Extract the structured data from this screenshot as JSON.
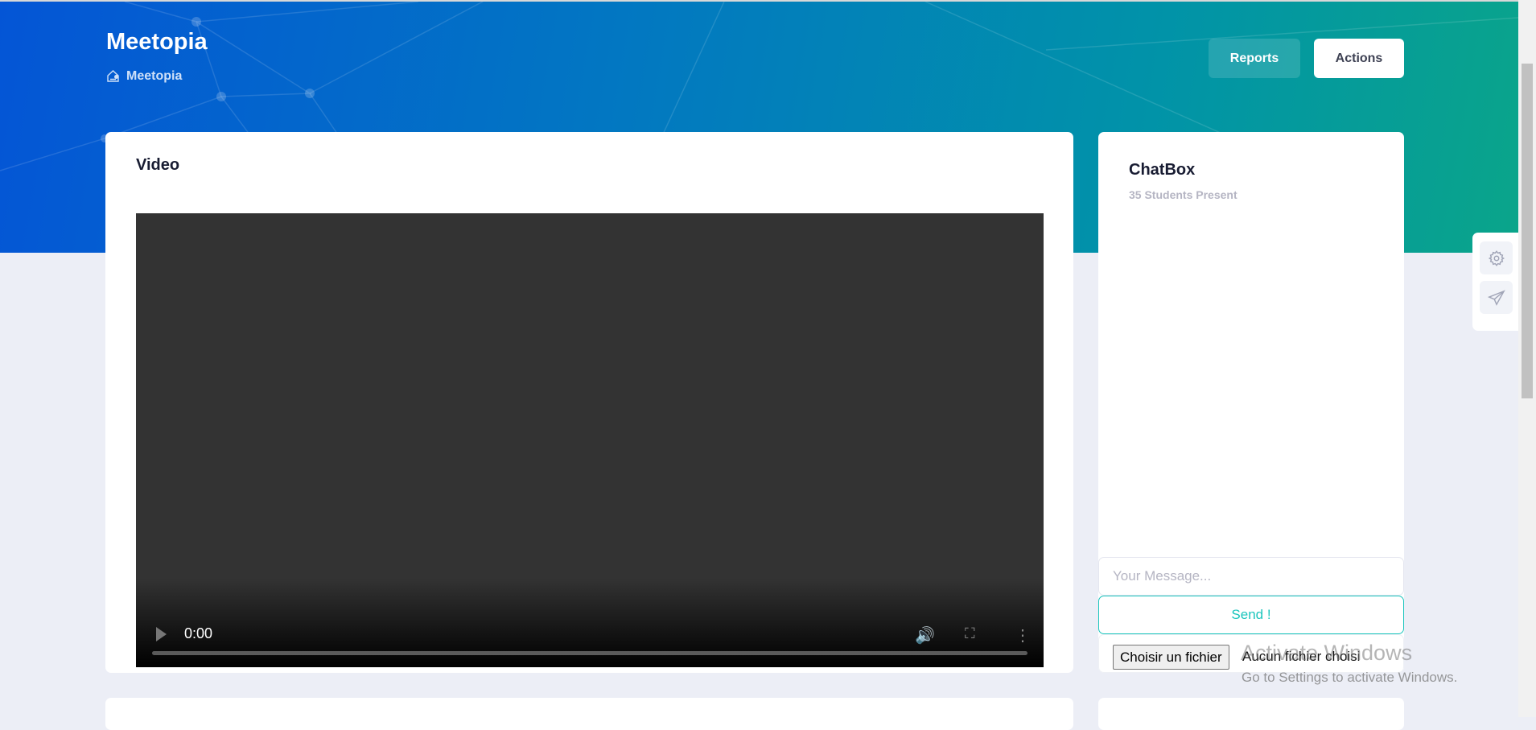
{
  "header": {
    "title": "Meetopia",
    "breadcrumb": "Meetopia",
    "reports_label": "Reports",
    "actions_label": "Actions"
  },
  "video": {
    "title": "Video",
    "time": "0:00",
    "progress": 0
  },
  "chat": {
    "title": "ChatBox",
    "students": "35 Students Present",
    "message_placeholder": "Your Message...",
    "send_label": "Send !",
    "file_button": "Choisir un fichier",
    "file_status": "Aucun fichier choisi"
  },
  "watermark": {
    "line1": "Activate Windows",
    "line2": "Go to Settings to activate Windows."
  },
  "colors": {
    "accent": "#1bc5bd",
    "hero_start": "#0455d6",
    "hero_end": "#0aa58a"
  }
}
